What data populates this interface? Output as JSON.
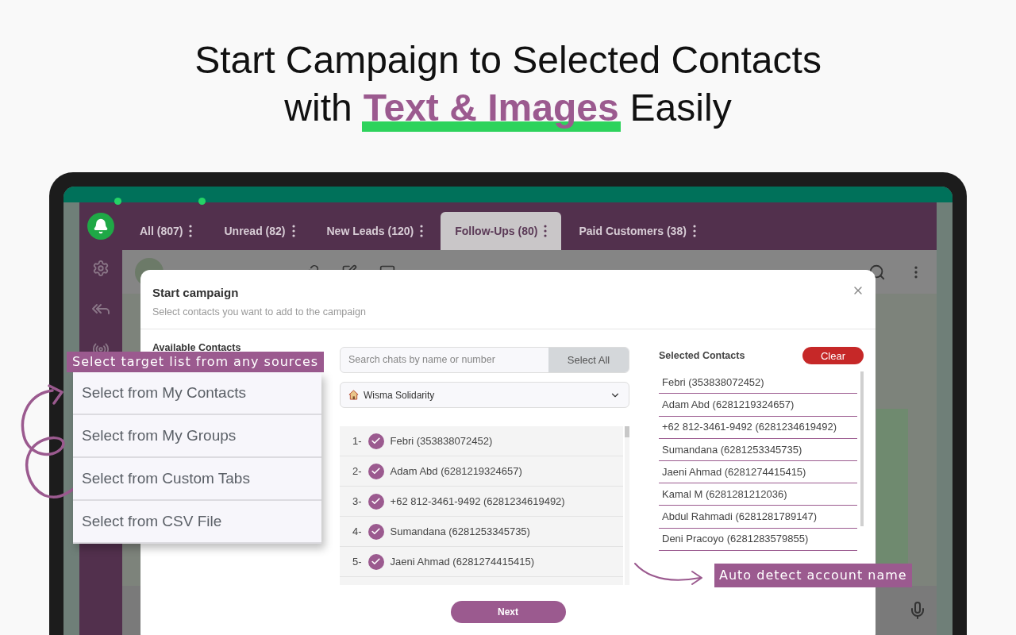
{
  "headline": {
    "line_1": "Start Campaign to Selected Contacts",
    "line_2_before": "with",
    "line_2_highlight": "Text & Images",
    "line_2_after": "Easily"
  },
  "tabs": [
    {
      "label": "All (807)",
      "selected": false,
      "badge": true
    },
    {
      "label": "Unread (82)",
      "selected": false,
      "badge": true
    },
    {
      "label": "New Leads (120)",
      "selected": false,
      "badge": false
    },
    {
      "label": "Follow-Ups (80)",
      "selected": true,
      "badge": false
    },
    {
      "label": "Paid Customers (38)",
      "selected": false,
      "badge": false
    }
  ],
  "modal": {
    "title": "Start campaign",
    "subtitle": "Select contacts you want to add to the campaign",
    "available_heading": "Available Contacts",
    "search": {
      "placeholder": "Search chats by name or number"
    },
    "select_all": "Select All",
    "source": "Wisma Solidarity",
    "contacts": [
      {
        "index": "1-",
        "name": "Febri (353838072452)",
        "checked": true
      },
      {
        "index": "2-",
        "name": "Adam Abd (6281219324657)",
        "checked": true
      },
      {
        "index": "3-",
        "name": "+62 812-3461-9492 (6281234619492)",
        "checked": true
      },
      {
        "index": "4-",
        "name": "Sumandana (6281253345735)",
        "checked": true
      },
      {
        "index": "5-",
        "name": "Jaeni Ahmad (6281274415415)",
        "checked": true
      }
    ],
    "selected_heading": "Selected Contacts",
    "clear": "Clear",
    "selected": [
      "Febri (353838072452)",
      "Adam Abd (6281219324657)",
      "+62 812-3461-9492 (6281234619492)",
      "Sumandana (6281253345735)",
      "Jaeni Ahmad (6281274415415)",
      "Kamal M (6281281212036)",
      "Abdul Rahmadi (6281281789147)",
      "Deni Pracoyo (6281283579855)"
    ],
    "next": "Next"
  },
  "callout_sources": {
    "label": "Select target list from any sources",
    "options": [
      "Select from My Contacts",
      "Select from My Groups",
      "Select from Custom Tabs",
      "Select from CSV File"
    ]
  },
  "callout_detect": {
    "label": "Auto detect account name"
  }
}
